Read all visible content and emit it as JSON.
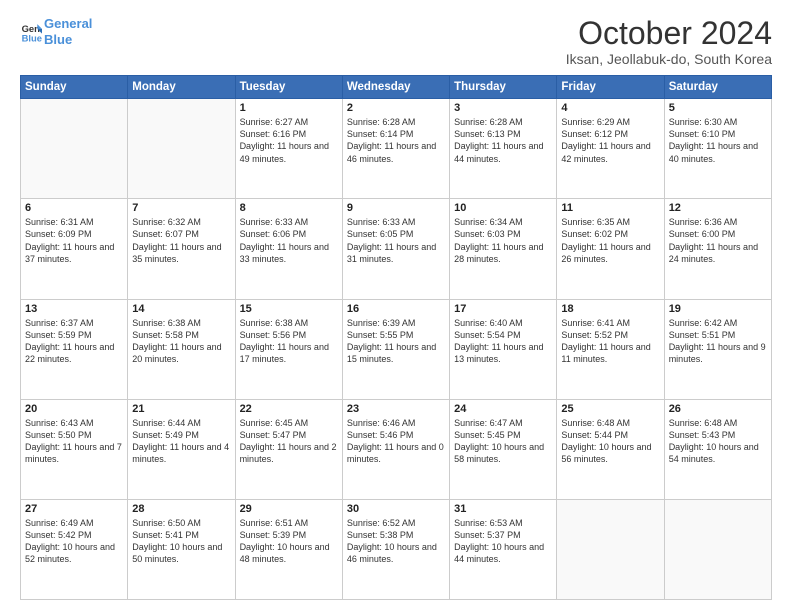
{
  "logo": {
    "line1": "General",
    "line2": "Blue"
  },
  "title": "October 2024",
  "location": "Iksan, Jeollabuk-do, South Korea",
  "days_of_week": [
    "Sunday",
    "Monday",
    "Tuesday",
    "Wednesday",
    "Thursday",
    "Friday",
    "Saturday"
  ],
  "weeks": [
    [
      {
        "day": "",
        "sunrise": "",
        "sunset": "",
        "daylight": ""
      },
      {
        "day": "",
        "sunrise": "",
        "sunset": "",
        "daylight": ""
      },
      {
        "day": "1",
        "sunrise": "Sunrise: 6:27 AM",
        "sunset": "Sunset: 6:16 PM",
        "daylight": "Daylight: 11 hours and 49 minutes."
      },
      {
        "day": "2",
        "sunrise": "Sunrise: 6:28 AM",
        "sunset": "Sunset: 6:14 PM",
        "daylight": "Daylight: 11 hours and 46 minutes."
      },
      {
        "day": "3",
        "sunrise": "Sunrise: 6:28 AM",
        "sunset": "Sunset: 6:13 PM",
        "daylight": "Daylight: 11 hours and 44 minutes."
      },
      {
        "day": "4",
        "sunrise": "Sunrise: 6:29 AM",
        "sunset": "Sunset: 6:12 PM",
        "daylight": "Daylight: 11 hours and 42 minutes."
      },
      {
        "day": "5",
        "sunrise": "Sunrise: 6:30 AM",
        "sunset": "Sunset: 6:10 PM",
        "daylight": "Daylight: 11 hours and 40 minutes."
      }
    ],
    [
      {
        "day": "6",
        "sunrise": "Sunrise: 6:31 AM",
        "sunset": "Sunset: 6:09 PM",
        "daylight": "Daylight: 11 hours and 37 minutes."
      },
      {
        "day": "7",
        "sunrise": "Sunrise: 6:32 AM",
        "sunset": "Sunset: 6:07 PM",
        "daylight": "Daylight: 11 hours and 35 minutes."
      },
      {
        "day": "8",
        "sunrise": "Sunrise: 6:33 AM",
        "sunset": "Sunset: 6:06 PM",
        "daylight": "Daylight: 11 hours and 33 minutes."
      },
      {
        "day": "9",
        "sunrise": "Sunrise: 6:33 AM",
        "sunset": "Sunset: 6:05 PM",
        "daylight": "Daylight: 11 hours and 31 minutes."
      },
      {
        "day": "10",
        "sunrise": "Sunrise: 6:34 AM",
        "sunset": "Sunset: 6:03 PM",
        "daylight": "Daylight: 11 hours and 28 minutes."
      },
      {
        "day": "11",
        "sunrise": "Sunrise: 6:35 AM",
        "sunset": "Sunset: 6:02 PM",
        "daylight": "Daylight: 11 hours and 26 minutes."
      },
      {
        "day": "12",
        "sunrise": "Sunrise: 6:36 AM",
        "sunset": "Sunset: 6:00 PM",
        "daylight": "Daylight: 11 hours and 24 minutes."
      }
    ],
    [
      {
        "day": "13",
        "sunrise": "Sunrise: 6:37 AM",
        "sunset": "Sunset: 5:59 PM",
        "daylight": "Daylight: 11 hours and 22 minutes."
      },
      {
        "day": "14",
        "sunrise": "Sunrise: 6:38 AM",
        "sunset": "Sunset: 5:58 PM",
        "daylight": "Daylight: 11 hours and 20 minutes."
      },
      {
        "day": "15",
        "sunrise": "Sunrise: 6:38 AM",
        "sunset": "Sunset: 5:56 PM",
        "daylight": "Daylight: 11 hours and 17 minutes."
      },
      {
        "day": "16",
        "sunrise": "Sunrise: 6:39 AM",
        "sunset": "Sunset: 5:55 PM",
        "daylight": "Daylight: 11 hours and 15 minutes."
      },
      {
        "day": "17",
        "sunrise": "Sunrise: 6:40 AM",
        "sunset": "Sunset: 5:54 PM",
        "daylight": "Daylight: 11 hours and 13 minutes."
      },
      {
        "day": "18",
        "sunrise": "Sunrise: 6:41 AM",
        "sunset": "Sunset: 5:52 PM",
        "daylight": "Daylight: 11 hours and 11 minutes."
      },
      {
        "day": "19",
        "sunrise": "Sunrise: 6:42 AM",
        "sunset": "Sunset: 5:51 PM",
        "daylight": "Daylight: 11 hours and 9 minutes."
      }
    ],
    [
      {
        "day": "20",
        "sunrise": "Sunrise: 6:43 AM",
        "sunset": "Sunset: 5:50 PM",
        "daylight": "Daylight: 11 hours and 7 minutes."
      },
      {
        "day": "21",
        "sunrise": "Sunrise: 6:44 AM",
        "sunset": "Sunset: 5:49 PM",
        "daylight": "Daylight: 11 hours and 4 minutes."
      },
      {
        "day": "22",
        "sunrise": "Sunrise: 6:45 AM",
        "sunset": "Sunset: 5:47 PM",
        "daylight": "Daylight: 11 hours and 2 minutes."
      },
      {
        "day": "23",
        "sunrise": "Sunrise: 6:46 AM",
        "sunset": "Sunset: 5:46 PM",
        "daylight": "Daylight: 11 hours and 0 minutes."
      },
      {
        "day": "24",
        "sunrise": "Sunrise: 6:47 AM",
        "sunset": "Sunset: 5:45 PM",
        "daylight": "Daylight: 10 hours and 58 minutes."
      },
      {
        "day": "25",
        "sunrise": "Sunrise: 6:48 AM",
        "sunset": "Sunset: 5:44 PM",
        "daylight": "Daylight: 10 hours and 56 minutes."
      },
      {
        "day": "26",
        "sunrise": "Sunrise: 6:48 AM",
        "sunset": "Sunset: 5:43 PM",
        "daylight": "Daylight: 10 hours and 54 minutes."
      }
    ],
    [
      {
        "day": "27",
        "sunrise": "Sunrise: 6:49 AM",
        "sunset": "Sunset: 5:42 PM",
        "daylight": "Daylight: 10 hours and 52 minutes."
      },
      {
        "day": "28",
        "sunrise": "Sunrise: 6:50 AM",
        "sunset": "Sunset: 5:41 PM",
        "daylight": "Daylight: 10 hours and 50 minutes."
      },
      {
        "day": "29",
        "sunrise": "Sunrise: 6:51 AM",
        "sunset": "Sunset: 5:39 PM",
        "daylight": "Daylight: 10 hours and 48 minutes."
      },
      {
        "day": "30",
        "sunrise": "Sunrise: 6:52 AM",
        "sunset": "Sunset: 5:38 PM",
        "daylight": "Daylight: 10 hours and 46 minutes."
      },
      {
        "day": "31",
        "sunrise": "Sunrise: 6:53 AM",
        "sunset": "Sunset: 5:37 PM",
        "daylight": "Daylight: 10 hours and 44 minutes."
      },
      {
        "day": "",
        "sunrise": "",
        "sunset": "",
        "daylight": ""
      },
      {
        "day": "",
        "sunrise": "",
        "sunset": "",
        "daylight": ""
      }
    ]
  ]
}
